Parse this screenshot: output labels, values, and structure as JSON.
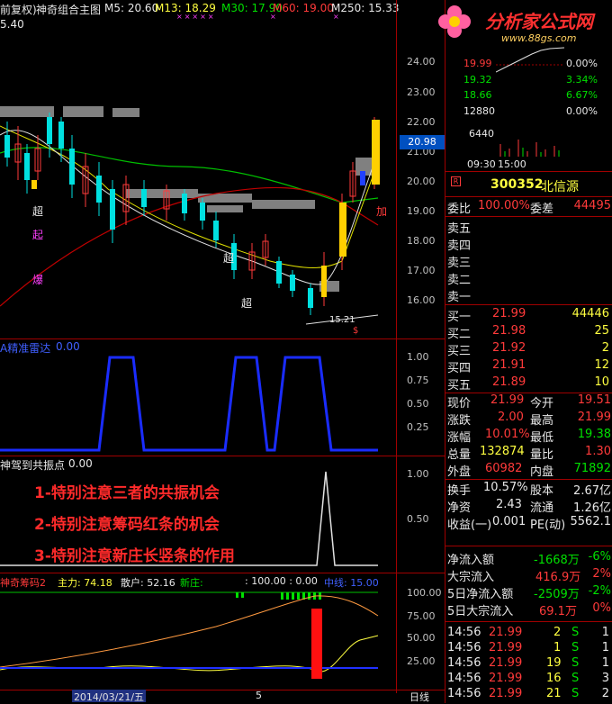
{
  "header": {
    "title_prefix": "前复权)",
    "indicator_name": "神奇组合主图",
    "ma5": "M5: 20.60",
    "ma13": "M13: 18.29",
    "ma30": "M30: 17.90",
    "ma60": "M60: 19.00",
    "ma250": "M250: 15.33",
    "left_value": "5.40"
  },
  "logo": {
    "name": "分析家公式网",
    "url": "www.88gs.com"
  },
  "price_axis": [
    "24.00",
    "23.00",
    "22.00",
    "21.00",
    "20.00",
    "19.00",
    "18.00",
    "17.00",
    "16.00"
  ],
  "current_price_tag": "20.98",
  "chart_marks": {
    "chao": "超",
    "qi": "起",
    "bao": "爆",
    "jia": "加",
    "low_label": "15.21",
    "marker": "$"
  },
  "panel2": {
    "title": "A精准雷达",
    "value": "0.00",
    "axis": [
      "1.00",
      "0.75",
      "0.50",
      "0.25"
    ]
  },
  "panel3": {
    "title": "神驾到共振点",
    "value": "0.00",
    "axis": [
      "1.00",
      "0.50"
    ]
  },
  "notes": [
    "1-特别注意三者的共振机会",
    "2-特别注意筹码红条的机会",
    "3-特别注意新庄长竖条的作用"
  ],
  "panel4": {
    "title": "神奇筹码2",
    "main_force": "主力: 74.18",
    "retail": "散户: 52.16",
    "new_dealer": "新庄: ",
    "mid_val": ": 100.00 : 0.00",
    "zhongxian": "中线: 15.00",
    "axis": [
      "100.00",
      "75.00",
      "50.00",
      "25.00"
    ]
  },
  "bottom_bar": {
    "date": "2014/03/21/五",
    "tick": "5",
    "period": "日线"
  },
  "mini_chart": {
    "prices": [
      "19.99",
      "19.32",
      "18.66",
      "12880",
      "6440"
    ],
    "pcts": [
      "0.00%",
      "3.34%",
      "6.67%",
      "0.00%"
    ],
    "time_start": "09:30",
    "time_end": "15:00"
  },
  "stock": {
    "code": "300352",
    "name": "北信源"
  },
  "weibi": {
    "label": "委比",
    "value": "100.00%",
    "cha_label": "委差",
    "cha_value": "44495"
  },
  "sells": [
    {
      "label": "卖五",
      "price": "",
      "vol": ""
    },
    {
      "label": "卖四",
      "price": "",
      "vol": ""
    },
    {
      "label": "卖三",
      "price": "",
      "vol": ""
    },
    {
      "label": "卖二",
      "price": "",
      "vol": ""
    },
    {
      "label": "卖一",
      "price": "",
      "vol": ""
    }
  ],
  "buys": [
    {
      "label": "买一",
      "price": "21.99",
      "vol": "44446"
    },
    {
      "label": "买二",
      "price": "21.98",
      "vol": "25"
    },
    {
      "label": "买三",
      "price": "21.92",
      "vol": "2"
    },
    {
      "label": "买四",
      "price": "21.91",
      "vol": "12"
    },
    {
      "label": "买五",
      "price": "21.89",
      "vol": "10"
    }
  ],
  "quote": [
    {
      "l1": "现价",
      "v1": "21.99",
      "l2": "今开",
      "v2": "19.51"
    },
    {
      "l1": "涨跌",
      "v1": "2.00",
      "l2": "最高",
      "v2": "21.99"
    },
    {
      "l1": "涨幅",
      "v1": "10.01%",
      "l2": "最低",
      "v2": "19.38"
    },
    {
      "l1": "总量",
      "v1": "132874",
      "l2": "量比",
      "v2": "1.30"
    },
    {
      "l1": "外盘",
      "v1": "60982",
      "l2": "内盘",
      "v2": "71892"
    }
  ],
  "fund": [
    {
      "l1": "换手",
      "v1": "10.57%",
      "l2": "股本",
      "v2": "2.67亿"
    },
    {
      "l1": "净资",
      "v1": "2.43",
      "l2": "流通",
      "v2": "1.26亿"
    },
    {
      "l1": "收益(一)",
      "v1": "0.001",
      "l2": "PE(动)",
      "v2": "5562.1"
    }
  ],
  "flow": [
    {
      "label": "净流入额",
      "value": "-1668万",
      "pct": "-6%"
    },
    {
      "label": "大宗流入",
      "value": "416.9万",
      "pct": "2%"
    },
    {
      "label": "5日净流入额",
      "value": "-2509万",
      "pct": "-2%"
    },
    {
      "label": "5日大宗流入",
      "value": "69.1万",
      "pct": "0%"
    }
  ],
  "ticks": [
    {
      "time": "14:56",
      "price": "21.99",
      "vol": "2",
      "side": "S",
      "n": "1"
    },
    {
      "time": "14:56",
      "price": "21.99",
      "vol": "1",
      "side": "S",
      "n": "1"
    },
    {
      "time": "14:56",
      "price": "21.99",
      "vol": "19",
      "side": "S",
      "n": "1"
    },
    {
      "time": "14:56",
      "price": "21.99",
      "vol": "16",
      "side": "S",
      "n": "3"
    },
    {
      "time": "14:56",
      "price": "21.99",
      "vol": "21",
      "side": "S",
      "n": "2"
    }
  ],
  "colors": {
    "up": "#ff3a3a",
    "down": "#00e000",
    "border": "#a00000",
    "blue_line": "#2030ff",
    "yellow": "#ffff40"
  }
}
